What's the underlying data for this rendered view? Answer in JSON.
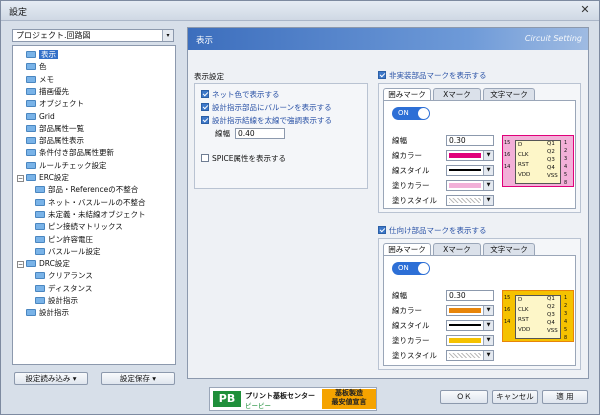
{
  "window": {
    "title": "設定",
    "close_glyph": "✕"
  },
  "category_select": {
    "value": "プロジェクト.回路図",
    "arrow": "▾"
  },
  "tree": {
    "items": [
      {
        "label": "表示",
        "level": 0,
        "selected": true
      },
      {
        "label": "色",
        "level": 0
      },
      {
        "label": "メモ",
        "level": 0
      },
      {
        "label": "描画優先",
        "level": 0
      },
      {
        "label": "オブジェクト",
        "level": 0
      },
      {
        "label": "Grid",
        "level": 0
      },
      {
        "label": "部品属性一覧",
        "level": 0
      },
      {
        "label": "部品属性表示",
        "level": 0
      },
      {
        "label": "条件付き部品属性更新",
        "level": 0
      },
      {
        "label": "ルールチェック設定",
        "level": 0
      },
      {
        "label": "ERC設定",
        "level": 0,
        "expander": "−"
      },
      {
        "label": "部品・Referenceの不整合",
        "level": 1
      },
      {
        "label": "ネット・バスルールの不整合",
        "level": 1
      },
      {
        "label": "未定義・未結線オブジェクト",
        "level": 1
      },
      {
        "label": "ピン接続マトリックス",
        "level": 1
      },
      {
        "label": "ピン許容電圧",
        "level": 1
      },
      {
        "label": "バスルール設定",
        "level": 1
      },
      {
        "label": "DRC設定",
        "level": 0,
        "expander": "−"
      },
      {
        "label": "クリアランス",
        "level": 1
      },
      {
        "label": "ディスタンス",
        "level": 1
      },
      {
        "label": "設計指示",
        "level": 1
      },
      {
        "label": "設計指示",
        "level": 0
      }
    ]
  },
  "bottom_left": {
    "load_label": "設定読み込み ▾",
    "save_label": "設定保存 ▾"
  },
  "panel": {
    "title": "表示",
    "subtitle": "Circuit Setting"
  },
  "display_settings": {
    "title": "表示設定",
    "net_color": "ネット色で表示する",
    "balloon": "設計指示部品にバルーンを表示する",
    "bold_line": "設計指示結線を太線で強調表示する",
    "width_label": "線幅",
    "width_value": "0.40",
    "spice": "SPICE属性を表示する"
  },
  "unmounted": {
    "title": "非実装部品マークを表示する",
    "tabs": [
      "囲みマーク",
      "Xマーク",
      "文字マーク"
    ],
    "toggle": "ON",
    "line_width_label": "線幅",
    "line_width": "0.30",
    "line_color_label": "線カラー",
    "line_style_label": "線スタイル",
    "fill_color_label": "塗りカラー",
    "fill_style_label": "塗りスタイル",
    "line_color": "#e0007a",
    "fill_color": "#f2b0d8"
  },
  "supplied": {
    "title": "仕向け部品マークを表示する",
    "tabs": [
      "囲みマーク",
      "Xマーク",
      "文字マーク"
    ],
    "toggle": "ON",
    "line_width_label": "線幅",
    "line_width": "0.30",
    "line_color_label": "線カラー",
    "line_style_label": "線スタイル",
    "fill_color_label": "塗りカラー",
    "fill_style_label": "塗りスタイル",
    "line_color": "#e8850a",
    "fill_color": "#f5c200"
  },
  "chip": {
    "left_pins": [
      "D",
      "CLK",
      "RST",
      "VDD"
    ],
    "right_pins": [
      "Q1",
      "Q2",
      "Q3",
      "Q4",
      "VSS"
    ],
    "left_nums": [
      "15",
      "16",
      "14"
    ],
    "right_nums": [
      "1",
      "2",
      "3",
      "4",
      "5",
      "8"
    ]
  },
  "logo": {
    "mark": "PB",
    "line1": "プリント基板センター",
    "line2": "ピーピー",
    "badge1": "基板製造",
    "badge2": "最安値宣言"
  },
  "footer": {
    "ok": "ＯＫ",
    "cancel": "キャンセル",
    "apply": "適 用"
  }
}
